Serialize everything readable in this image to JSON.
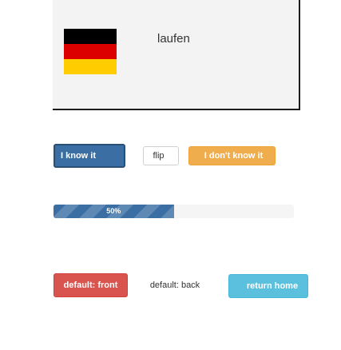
{
  "card": {
    "word": "laufen",
    "flag_icon": "germany-flag-icon",
    "flag_colors": [
      "#000000",
      "#dd0000",
      "#ffcc00"
    ]
  },
  "answer_buttons": {
    "know_label": "I know it",
    "flip_label": "flip",
    "dont_know_label": "I don't know it"
  },
  "progress": {
    "label": "50%",
    "value": 0.5
  },
  "mode_buttons": {
    "front_label": "default: front",
    "back_label": "default: back",
    "home_label": "return home"
  },
  "colors": {
    "primary": "#3b6fa3",
    "warning": "#f0ad4e",
    "danger": "#d9534f",
    "info": "#5bc0de"
  }
}
